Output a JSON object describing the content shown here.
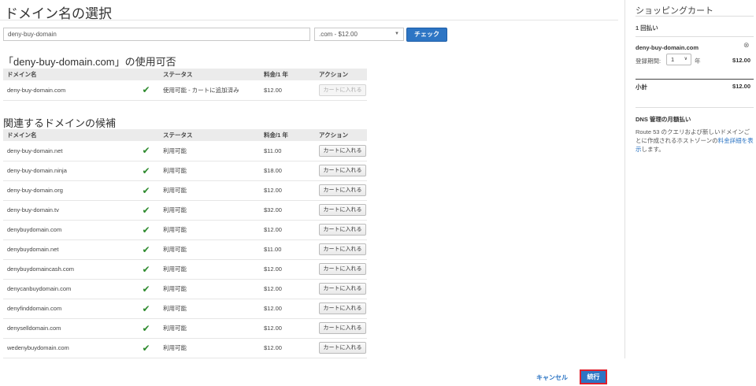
{
  "page": {
    "title": "ドメイン名の選択"
  },
  "search": {
    "value": "deny-buy-domain",
    "tld_selected": ".com - $12.00",
    "check_label": "チェック"
  },
  "availability": {
    "title": "「deny-buy-domain.com」の使用可否",
    "headers": [
      "ドメイン名",
      "",
      "ステータス",
      "料金/1 年",
      "アクション"
    ],
    "row": {
      "domain": "deny-buy-domain.com",
      "status": "使用可能 - カートに追加済み",
      "price": "$12.00",
      "action": "カートに入れる"
    }
  },
  "suggestions": {
    "title": "関連するドメインの候補",
    "headers": [
      "ドメイン名",
      "",
      "ステータス",
      "料金/1 年",
      "アクション"
    ],
    "rows": [
      {
        "domain": "deny-buy-domain.net",
        "status": "利用可能",
        "price": "$11.00",
        "action": "カートに入れる"
      },
      {
        "domain": "deny-buy-domain.ninja",
        "status": "利用可能",
        "price": "$18.00",
        "action": "カートに入れる"
      },
      {
        "domain": "deny-buy-domain.org",
        "status": "利用可能",
        "price": "$12.00",
        "action": "カートに入れる"
      },
      {
        "domain": "deny-buy-domain.tv",
        "status": "利用可能",
        "price": "$32.00",
        "action": "カートに入れる"
      },
      {
        "domain": "denybuydomain.com",
        "status": "利用可能",
        "price": "$12.00",
        "action": "カートに入れる"
      },
      {
        "domain": "denybuydomain.net",
        "status": "利用可能",
        "price": "$11.00",
        "action": "カートに入れる"
      },
      {
        "domain": "denybuydomaincash.com",
        "status": "利用可能",
        "price": "$12.00",
        "action": "カートに入れる"
      },
      {
        "domain": "denycanbuydomain.com",
        "status": "利用可能",
        "price": "$12.00",
        "action": "カートに入れる"
      },
      {
        "domain": "denyfinddomain.com",
        "status": "利用可能",
        "price": "$12.00",
        "action": "カートに入れる"
      },
      {
        "domain": "denyselldomain.com",
        "status": "利用可能",
        "price": "$12.00",
        "action": "カートに入れる"
      },
      {
        "domain": "wedenybuydomain.com",
        "status": "利用可能",
        "price": "$12.00",
        "action": "カートに入れる"
      }
    ]
  },
  "footer": {
    "cancel_label": "キャンセル",
    "continue_label": "続行"
  },
  "cart": {
    "title": "ショッピングカート",
    "pay_once": "1 回払い",
    "domain": "deny-buy-domain.com",
    "period_label": "登録期間:",
    "period_value": "1",
    "period_unit": "年",
    "price": "$12.00",
    "subtotal_label": "小計",
    "subtotal_value": "$12.00",
    "dns_title": "DNS 管理の月額払い",
    "dns_text_before": "Route 53 のクエリおよび新しいドメインごとに作成されるホストゾーンの",
    "dns_link": "料金詳細を表示",
    "dns_text_after": "します。"
  },
  "icons": {
    "available": "checkmark-icon",
    "remove": "remove-circle-icon",
    "dropdown": "caret-down-icon"
  },
  "colors": {
    "accent": "#2d75c4",
    "available_check": "#2d8a2d",
    "highlight_border": "#e0202d",
    "table_header_bg": "#ebebeb"
  }
}
